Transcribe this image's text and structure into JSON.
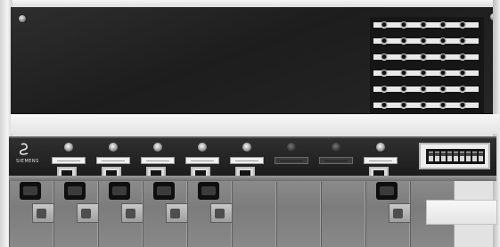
{
  "panel": {
    "brand_text": "SIEMENS"
  }
}
